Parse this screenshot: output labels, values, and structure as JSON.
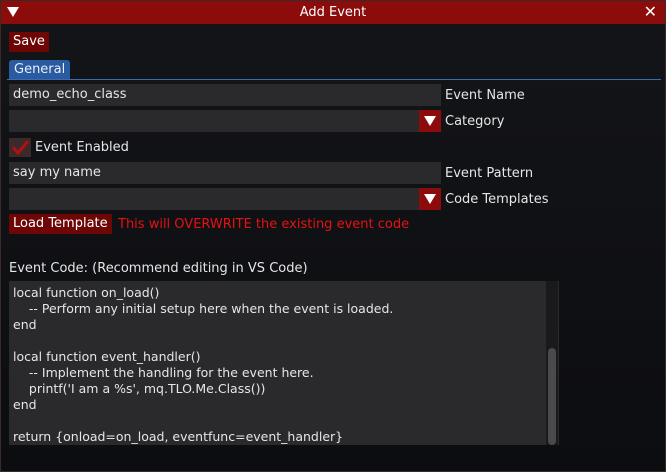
{
  "window": {
    "title": "Add Event"
  },
  "toolbar": {
    "save_label": "Save"
  },
  "tabs": [
    {
      "label": "General"
    }
  ],
  "form": {
    "event_name": {
      "value": "demo_echo_class",
      "label": "Event Name"
    },
    "category": {
      "value": "",
      "label": "Category"
    },
    "event_enabled": {
      "checked": true,
      "label": "Event Enabled"
    },
    "event_pattern": {
      "value": "say my name",
      "label": "Event Pattern"
    },
    "code_templates": {
      "value": "",
      "label": "Code Templates"
    },
    "load_template_label": "Load Template",
    "warning": "This will OVERWRITE the existing event code",
    "event_code_label": "Event Code: (Recommend editing in VS Code)"
  },
  "code_lines": [
    "local function on_load()",
    "    -- Perform any initial setup here when the event is loaded.",
    "end",
    "",
    "local function event_handler()",
    "    -- Implement the handling for the event here.",
    "    printf('I am a %s', mq.TLO.Me.Class())",
    "end",
    "",
    "return {onload=on_load, eventfunc=event_handler}"
  ],
  "colors": {
    "title_bar": "#8c0c0c",
    "button": "#6e0606",
    "tab": "#2a5aa0",
    "warning": "#e81010",
    "field_bg": "#2a2a2d"
  },
  "icons": {
    "collapse": "triangle-down-icon",
    "close": "close-icon",
    "dropdown": "chevron-down-icon",
    "check": "checkmark-icon"
  }
}
